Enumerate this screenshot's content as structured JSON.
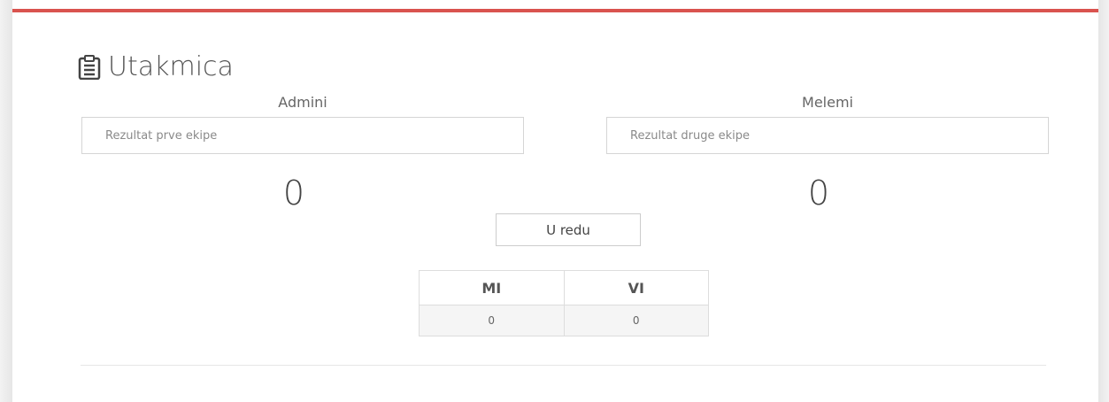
{
  "page": {
    "title": "Utakmica",
    "title_icon": "clipboard-icon",
    "accent_color": "#d9534f"
  },
  "teams": {
    "first": {
      "name": "Admini",
      "placeholder": "Rezultat prve ekipe",
      "score": "0"
    },
    "second": {
      "name": "Melemi",
      "placeholder": "Rezultat druge ekipe",
      "score": "0"
    }
  },
  "confirm_button": {
    "label": "U redu"
  },
  "results_table": {
    "headers": [
      "MI",
      "VI"
    ],
    "row": [
      "0",
      "0"
    ]
  }
}
